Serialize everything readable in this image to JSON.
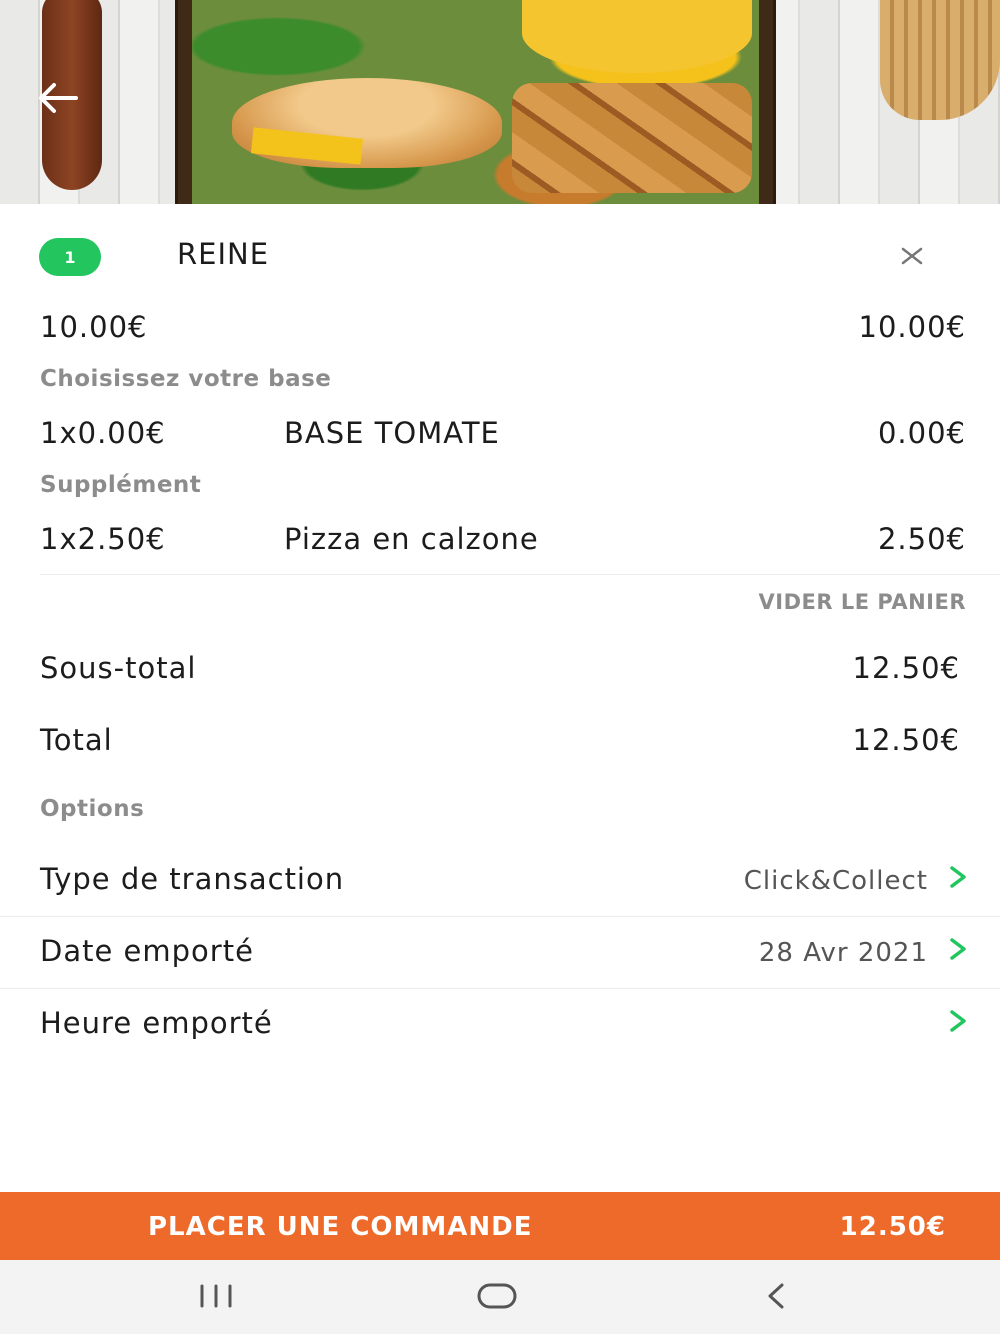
{
  "cart_item": {
    "quantity": "1",
    "name": "REINE",
    "unit_price": "10.00€",
    "line_total": "10.00€"
  },
  "choice_groups": [
    {
      "title": "Choisissez votre base",
      "qty_price": "1x0.00€",
      "option": "BASE TOMATE",
      "total": "0.00€"
    },
    {
      "title": "Supplément",
      "qty_price": "1x2.50€",
      "option": "Pizza en calzone",
      "total": "2.50€"
    }
  ],
  "clear_cart_label": "VIDER LE PANIER",
  "summary": {
    "subtotal_label": "Sous-total",
    "subtotal_value": "12.50€",
    "total_label": "Total",
    "total_value": "12.50€"
  },
  "options": {
    "title": "Options",
    "rows": [
      {
        "label": "Type de transaction",
        "value": "Click&Collect"
      },
      {
        "label": "Date emporté",
        "value": "28 Avr 2021"
      },
      {
        "label": "Heure emporté",
        "value": ""
      }
    ]
  },
  "order_button": {
    "label": "PLACER UNE COMMANDE",
    "amount": "12.50€"
  },
  "colors": {
    "accent_green": "#22c55e",
    "order_orange": "#ee6a2a",
    "muted_text": "#8c8c8c"
  },
  "icons": {
    "back": "arrow-left-icon",
    "remove": "close-icon",
    "chevron": "chevron-right-icon",
    "nav_recents": "recents-icon",
    "nav_home": "home-icon",
    "nav_back": "nav-back-icon"
  }
}
